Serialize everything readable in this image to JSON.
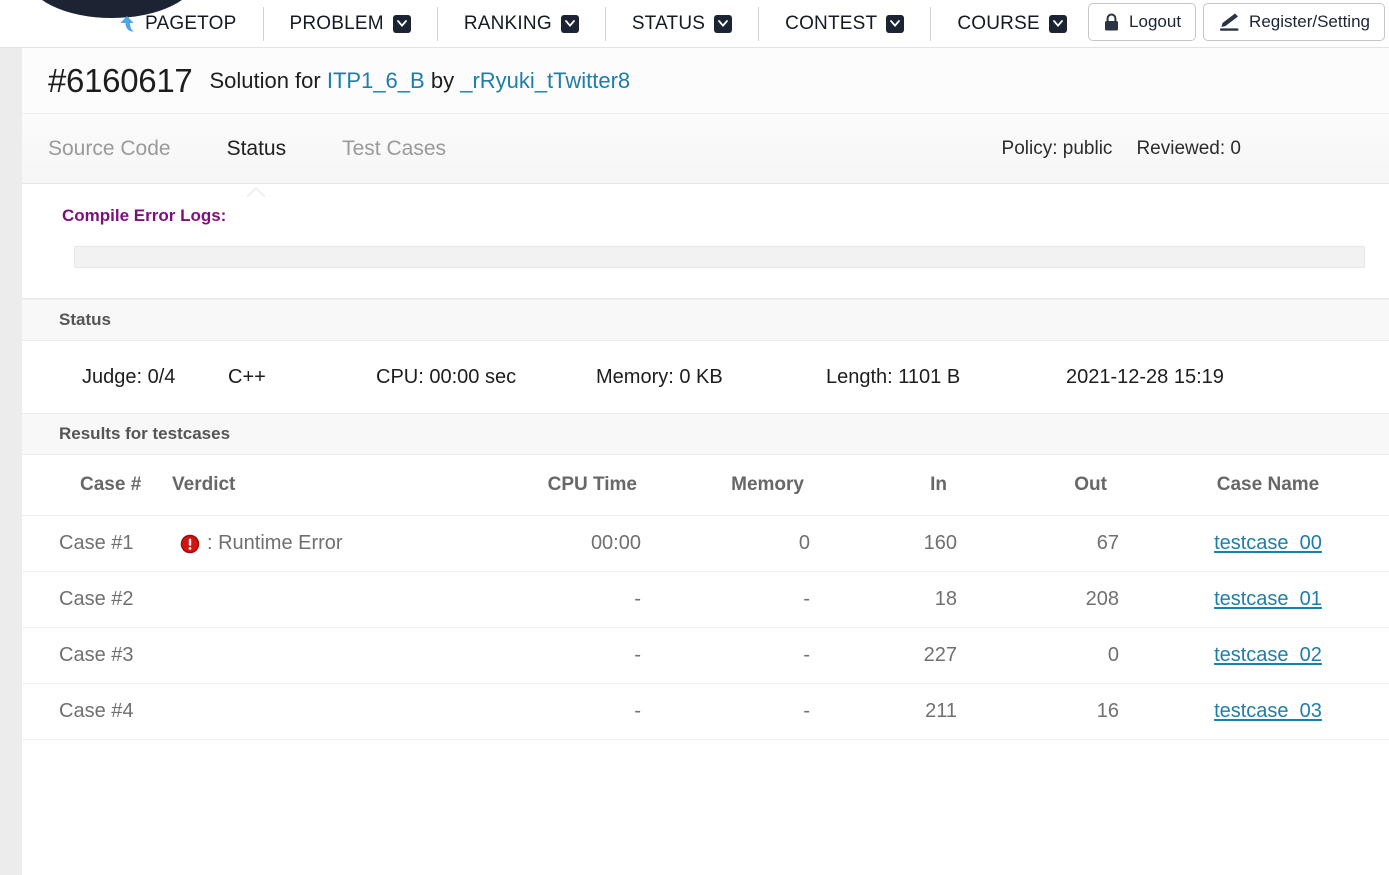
{
  "nav": {
    "brand": "PAGETOP",
    "brand_icon": "up-arrow-icon",
    "items": [
      {
        "label": "PROBLEM",
        "has_dropdown": true
      },
      {
        "label": "RANKING",
        "has_dropdown": true
      },
      {
        "label": "STATUS",
        "has_dropdown": true
      },
      {
        "label": "CONTEST",
        "has_dropdown": true
      },
      {
        "label": "COURSE",
        "has_dropdown": true
      }
    ],
    "buttons": [
      {
        "label": "Logout",
        "icon": "lock-icon"
      },
      {
        "label": "Register/Setting",
        "icon": "pencil-icon"
      }
    ]
  },
  "title": {
    "solution_id": "#6160617",
    "prefix": "Solution for",
    "problem_id": "ITP1_6_B",
    "by": "by",
    "user": "_rRyuki_tTwitter8"
  },
  "tabs": {
    "items": [
      {
        "label": "Source Code",
        "active": false
      },
      {
        "label": "Status",
        "active": true
      },
      {
        "label": "Test Cases",
        "active": false
      }
    ],
    "meta": [
      "Policy: public",
      "Reviewed: 0"
    ]
  },
  "compile_error": {
    "title": "Compile Error Logs:",
    "log_text": "",
    "accent_color": "#7d0f7d"
  },
  "status": {
    "section_title": "Status",
    "fields": [
      "Judge: 0/4",
      "C++",
      "CPU: 00:00 sec",
      "Memory: 0 KB",
      "Length: 1101 B",
      "2021-12-28 15:19"
    ]
  },
  "results": {
    "section_title": "Results for testcases",
    "columns": [
      "Case #",
      "Verdict",
      "CPU Time",
      "Memory",
      "In",
      "Out",
      "Case Name"
    ],
    "rows": [
      {
        "case": "Case #1",
        "verdict": ": Runtime Error",
        "verdict_icon": "error-circle-icon",
        "cpu_time": "00:00",
        "memory": "0",
        "in": "160",
        "out": "67",
        "case_name": "testcase_00"
      },
      {
        "case": "Case #2",
        "verdict": "",
        "verdict_icon": "",
        "cpu_time": "-",
        "memory": "-",
        "in": "18",
        "out": "208",
        "case_name": "testcase_01"
      },
      {
        "case": "Case #3",
        "verdict": "",
        "verdict_icon": "",
        "cpu_time": "-",
        "memory": "-",
        "in": "227",
        "out": "0",
        "case_name": "testcase_02"
      },
      {
        "case": "Case #4",
        "verdict": "",
        "verdict_icon": "",
        "cpu_time": "-",
        "memory": "-",
        "in": "211",
        "out": "16",
        "case_name": "testcase_03"
      }
    ]
  },
  "colors": {
    "link": "#1d7ea8",
    "error": "#d41313",
    "nav_dark": "#1c2433",
    "compile_title": "#7d0f7d"
  }
}
